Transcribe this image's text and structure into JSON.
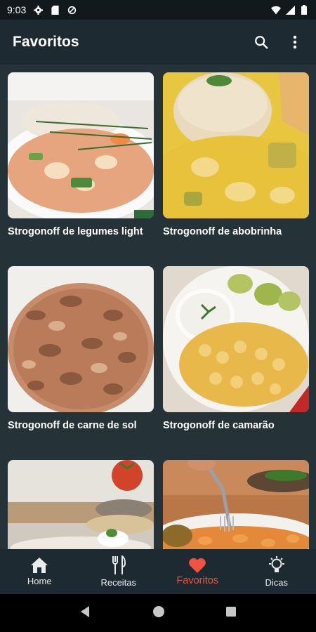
{
  "status_bar": {
    "time": "9:03"
  },
  "app_bar": {
    "title": "Favoritos",
    "search_icon": "search-icon",
    "menu_icon": "more-vert-icon"
  },
  "recipes": [
    {
      "title": "Strogonoff de legumes light"
    },
    {
      "title": "Strogonoff de abobrinha"
    },
    {
      "title": "Strogonoff de carne de sol"
    },
    {
      "title": "Strogonoff de camarão"
    },
    {
      "title": ""
    },
    {
      "title": ""
    }
  ],
  "bottom_nav": {
    "items": [
      {
        "label": "Home",
        "icon": "home-icon"
      },
      {
        "label": "Receitas",
        "icon": "fork-knife-icon"
      },
      {
        "label": "Favoritos",
        "icon": "heart-icon",
        "active": true
      },
      {
        "label": "Dicas",
        "icon": "lightbulb-icon"
      }
    ]
  },
  "colors": {
    "accent": "#f0533e",
    "background": "#253238",
    "bar": "#1e2a31"
  }
}
